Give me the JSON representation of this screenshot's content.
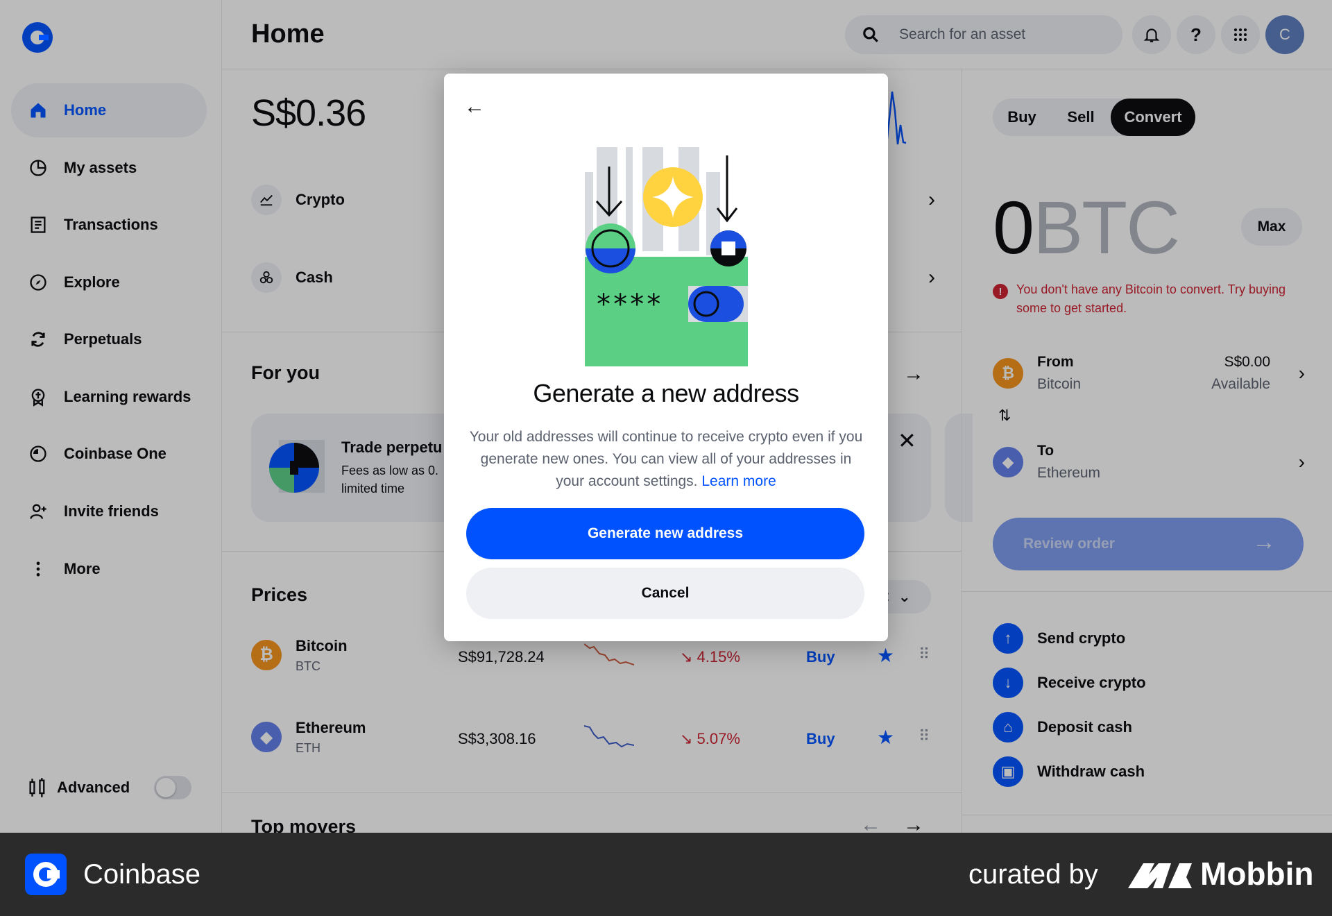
{
  "sidebar": {
    "items": [
      {
        "label": "Home",
        "icon": "home-icon"
      },
      {
        "label": "My assets",
        "icon": "pie-chart-icon"
      },
      {
        "label": "Transactions",
        "icon": "receipt-icon"
      },
      {
        "label": "Explore",
        "icon": "compass-icon"
      },
      {
        "label": "Perpetuals",
        "icon": "refresh-icon"
      },
      {
        "label": "Learning rewards",
        "icon": "reward-icon"
      },
      {
        "label": "Coinbase One",
        "icon": "coinbase-one-icon"
      },
      {
        "label": "Invite friends",
        "icon": "add-user-icon"
      },
      {
        "label": "More",
        "icon": "more-vertical-icon"
      }
    ],
    "advanced_label": "Advanced"
  },
  "header": {
    "title": "Home",
    "search_placeholder": "Search for an asset",
    "avatar_initial": "C"
  },
  "main": {
    "balance": "S$0.36",
    "rows": [
      {
        "label": "Crypto"
      },
      {
        "label": "Cash"
      }
    ],
    "for_you_title": "For you",
    "promo": {
      "title": "Trade perpetu",
      "line1": "Fees as low as 0.",
      "line2": "limited time"
    },
    "prices_title": "Prices",
    "prices_filter_partial": "t",
    "prices": [
      {
        "name": "Bitcoin",
        "symbol": "BTC",
        "price": "S$91,728.24",
        "change": "4.15%",
        "action": "Buy"
      },
      {
        "name": "Ethereum",
        "symbol": "ETH",
        "price": "S$3,308.16",
        "change": "5.07%",
        "action": "Buy"
      }
    ],
    "top_movers_title": "Top movers"
  },
  "trade": {
    "tabs": [
      "Buy",
      "Sell",
      "Convert"
    ],
    "active_tab": "Convert",
    "amount": "0",
    "unit": "BTC",
    "max_label": "Max",
    "warning": "You don't have any Bitcoin to convert. Try buying some to get started.",
    "from": {
      "label": "From",
      "asset": "Bitcoin",
      "value": "S$0.00",
      "sub": "Available"
    },
    "to": {
      "label": "To",
      "asset": "Ethereum"
    },
    "review_label": "Review order",
    "actions": [
      "Send crypto",
      "Receive crypto",
      "Deposit cash",
      "Withdraw cash"
    ]
  },
  "modal": {
    "title": "Generate a new address",
    "body": "Your old addresses will continue to receive crypto even if you generate new ones. You can view all of your addresses in your account settings.",
    "link": "Learn more",
    "primary": "Generate new address",
    "secondary": "Cancel",
    "illustration_text": "****"
  },
  "footer": {
    "app_name": "Coinbase",
    "curated": "curated by",
    "brand": "Mobbin"
  },
  "colors": {
    "brand": "#0052ff",
    "negative": "#cf202f",
    "bitcoin": "#f7931a",
    "ethereum": "#627eea",
    "green": "#5bd085",
    "yellow": "#ffd23f"
  }
}
